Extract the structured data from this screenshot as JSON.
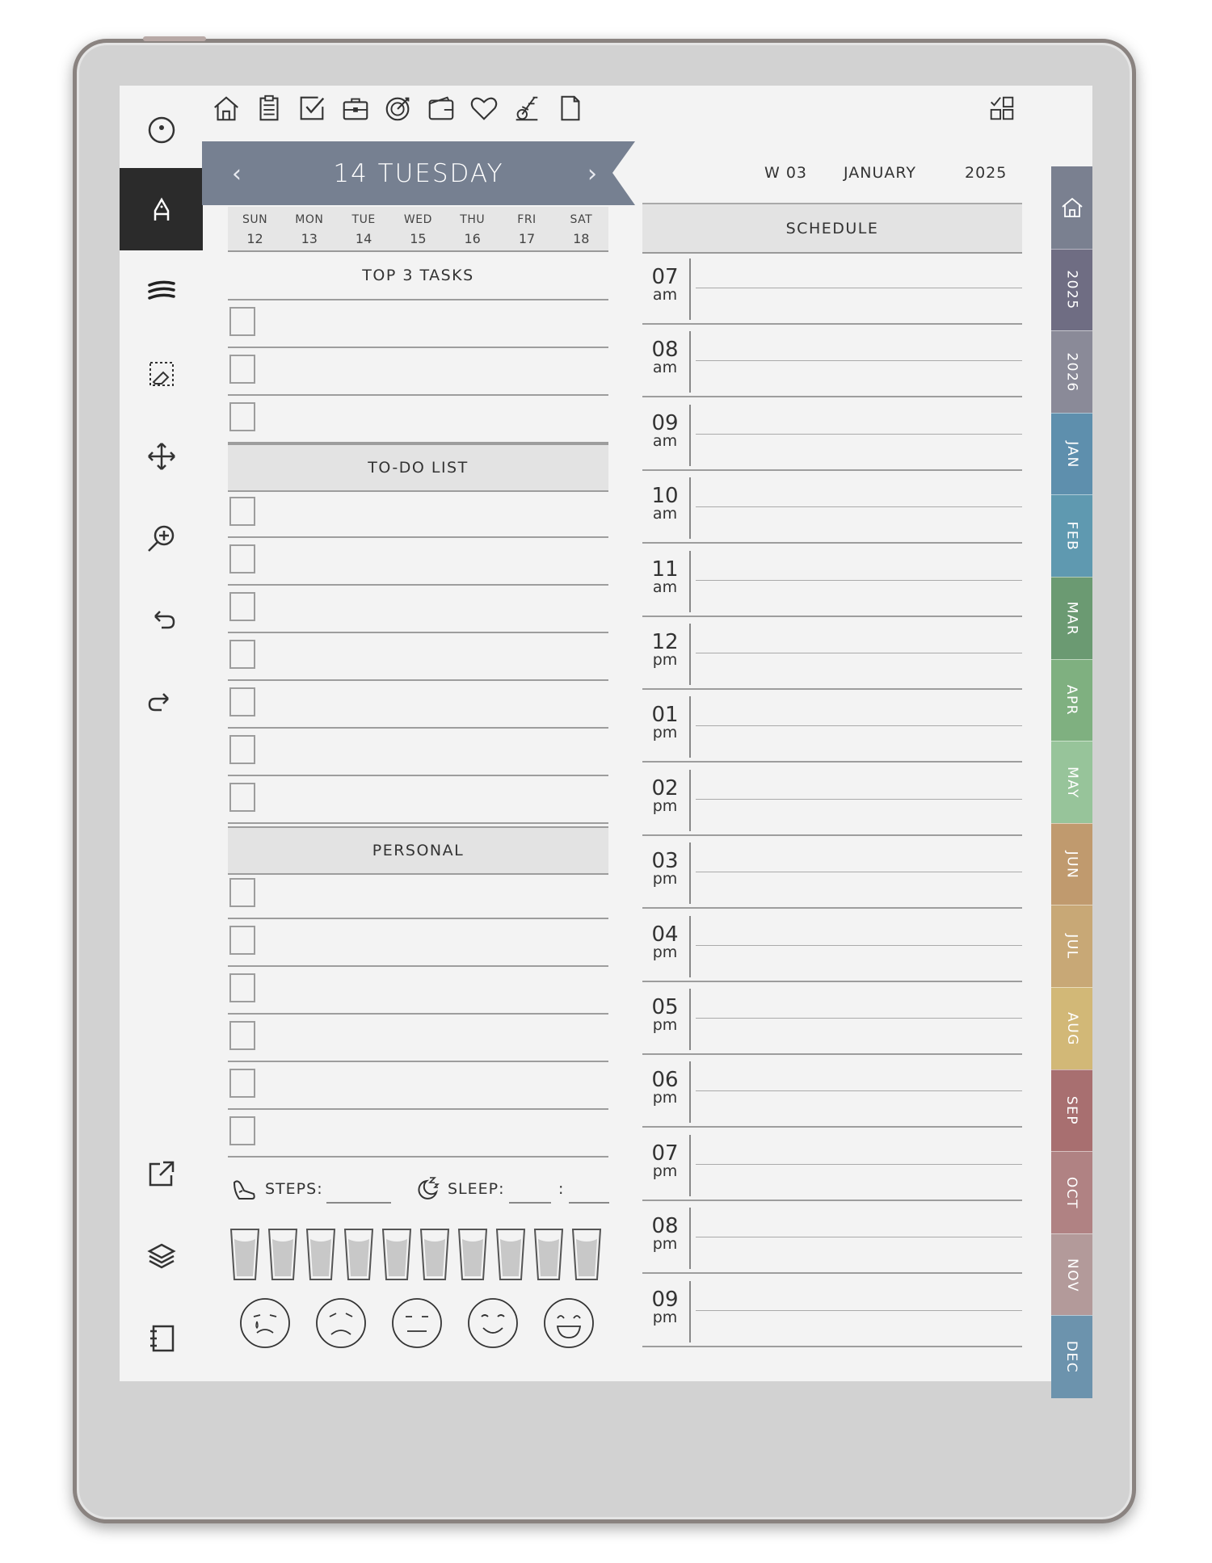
{
  "header": {
    "day_title": "14 TUESDAY",
    "prev_arrow": "‹",
    "next_arrow": "›",
    "week": "W 03",
    "month": "JANUARY",
    "year": "2025"
  },
  "week_strip": [
    {
      "day": "SUN",
      "num": "12"
    },
    {
      "day": "MON",
      "num": "13"
    },
    {
      "day": "TUE",
      "num": "14"
    },
    {
      "day": "WED",
      "num": "15"
    },
    {
      "day": "THU",
      "num": "16"
    },
    {
      "day": "FRI",
      "num": "17"
    },
    {
      "day": "SAT",
      "num": "18"
    }
  ],
  "sections": {
    "top_tasks": "TOP 3 TASKS",
    "todo": "TO-DO LIST",
    "personal": "PERSONAL",
    "schedule": "SCHEDULE"
  },
  "counts": {
    "top_tasks": 3,
    "todo": 7,
    "personal": 6,
    "water_glasses": 10
  },
  "trackers": {
    "steps_label": "STEPS:",
    "sleep_label": "SLEEP:",
    "sleep_sep": ":"
  },
  "moods": [
    "crying-face-icon",
    "sad-face-icon",
    "neutral-face-icon",
    "smile-face-icon",
    "grin-face-icon"
  ],
  "schedule": [
    {
      "hour": "07",
      "ampm": "am"
    },
    {
      "hour": "08",
      "ampm": "am"
    },
    {
      "hour": "09",
      "ampm": "am"
    },
    {
      "hour": "10",
      "ampm": "am"
    },
    {
      "hour": "11",
      "ampm": "am"
    },
    {
      "hour": "12",
      "ampm": "pm"
    },
    {
      "hour": "01",
      "ampm": "pm"
    },
    {
      "hour": "02",
      "ampm": "pm"
    },
    {
      "hour": "03",
      "ampm": "pm"
    },
    {
      "hour": "04",
      "ampm": "pm"
    },
    {
      "hour": "05",
      "ampm": "pm"
    },
    {
      "hour": "06",
      "ampm": "pm"
    },
    {
      "hour": "07",
      "ampm": "pm"
    },
    {
      "hour": "08",
      "ampm": "pm"
    },
    {
      "hour": "09",
      "ampm": "pm"
    }
  ],
  "tabs": [
    {
      "label": "home-icon",
      "color": "#7a8090",
      "icon": true
    },
    {
      "label": "2025",
      "color": "#6f6d83"
    },
    {
      "label": "2026",
      "color": "#8a8a98"
    },
    {
      "label": "JAN",
      "color": "#5e8fad"
    },
    {
      "label": "FEB",
      "color": "#5f99b0"
    },
    {
      "label": "MAR",
      "color": "#6b9a72"
    },
    {
      "label": "APR",
      "color": "#7fb080"
    },
    {
      "label": "MAY",
      "color": "#97c49a"
    },
    {
      "label": "JUN",
      "color": "#c09a6e"
    },
    {
      "label": "JUL",
      "color": "#c8a876"
    },
    {
      "label": "AUG",
      "color": "#d2b877"
    },
    {
      "label": "SEP",
      "color": "#a86f70"
    },
    {
      "label": "OCT",
      "color": "#b08283"
    },
    {
      "label": "NOV",
      "color": "#b39a9a"
    },
    {
      "label": "DEC",
      "color": "#6c93ad"
    }
  ],
  "colors": {
    "banner": "#768091",
    "toolbar_active": "#2b2b2b"
  },
  "top_icons": [
    "home-icon",
    "clipboard-icon",
    "checkbox-icon",
    "briefcase-icon",
    "target-icon",
    "wallet-icon",
    "heart-icon",
    "exercise-bike-icon",
    "page-icon"
  ],
  "toolbar_icons": [
    "circle-menu-icon",
    "pen-icon",
    "wave-lines-icon",
    "eraser-select-icon",
    "move-icon",
    "zoom-icon",
    "undo-icon",
    "redo-icon",
    "export-icon",
    "layers-icon",
    "notebook-icon"
  ]
}
